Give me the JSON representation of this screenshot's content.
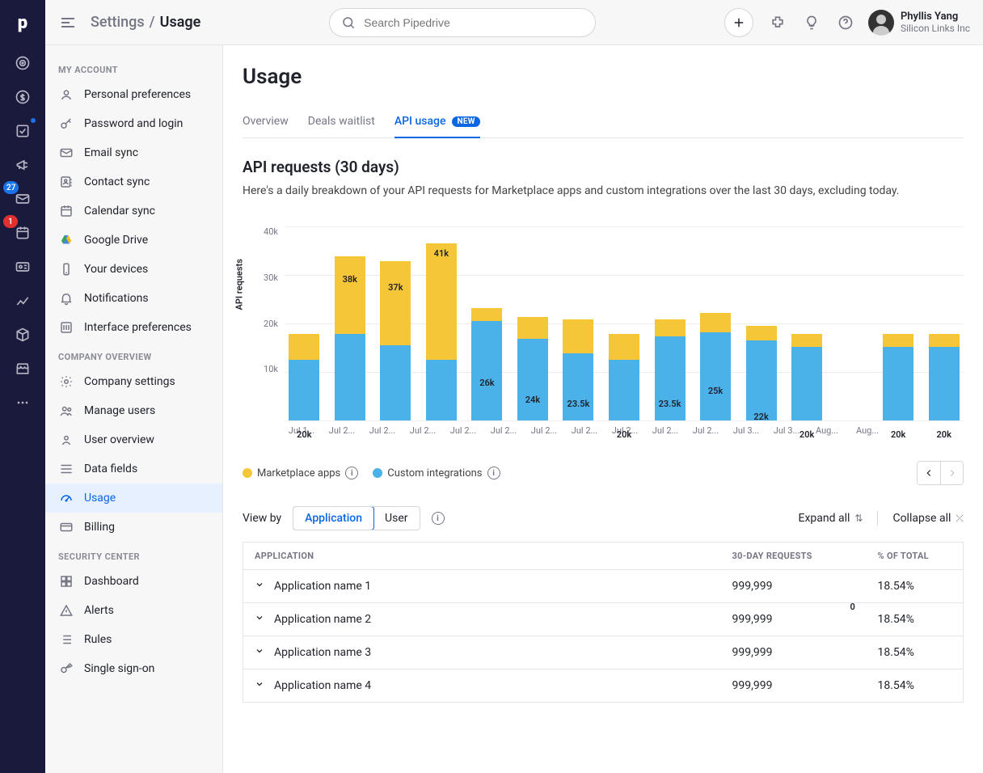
{
  "rail": {
    "items": [
      "target",
      "dollar",
      "checkbox",
      "campaign",
      "inbox",
      "calendar",
      "contact-card",
      "insights",
      "box",
      "store",
      "more"
    ],
    "inbox_badge": "27",
    "calendar_badge": "1"
  },
  "header": {
    "breadcrumb_root": "Settings",
    "breadcrumb_sep": "/",
    "breadcrumb_current": "Usage",
    "search_placeholder": "Search Pipedrive",
    "user_name": "Phyllis Yang",
    "user_company": "Silicon Links Inc"
  },
  "sidebar": {
    "sections": [
      {
        "heading": "MY ACCOUNT",
        "items": [
          {
            "label": "Personal preferences",
            "icon": "user"
          },
          {
            "label": "Password and login",
            "icon": "key"
          },
          {
            "label": "Email sync",
            "icon": "mail"
          },
          {
            "label": "Contact sync",
            "icon": "contacts"
          },
          {
            "label": "Calendar sync",
            "icon": "calendar"
          },
          {
            "label": "Google Drive",
            "icon": "gdrive"
          },
          {
            "label": "Your devices",
            "icon": "device"
          },
          {
            "label": "Notifications",
            "icon": "bell"
          },
          {
            "label": "Interface preferences",
            "icon": "sliders"
          }
        ]
      },
      {
        "heading": "COMPANY OVERVIEW",
        "items": [
          {
            "label": "Company settings",
            "icon": "gear"
          },
          {
            "label": "Manage users",
            "icon": "users"
          },
          {
            "label": "User overview",
            "icon": "userview"
          },
          {
            "label": "Data fields",
            "icon": "fields"
          },
          {
            "label": "Usage",
            "icon": "gauge",
            "active": true
          },
          {
            "label": "Billing",
            "icon": "billing"
          }
        ]
      },
      {
        "heading": "SECURITY CENTER",
        "items": [
          {
            "label": "Dashboard",
            "icon": "dashboard"
          },
          {
            "label": "Alerts",
            "icon": "alert"
          },
          {
            "label": "Rules",
            "icon": "rules"
          },
          {
            "label": "Single sign-on",
            "icon": "sso"
          }
        ]
      }
    ]
  },
  "page": {
    "title": "Usage",
    "tabs": [
      {
        "label": "Overview",
        "active": false
      },
      {
        "label": "Deals waitlist",
        "active": false
      },
      {
        "label": "API usage",
        "active": true,
        "badge": "NEW"
      }
    ],
    "section_title": "API requests (30 days)",
    "section_desc": "Here's a daily breakdown of your API requests for Marketplace apps and custom integrations over the last 30 days, excluding today.",
    "legend": [
      {
        "label": "Marketplace apps",
        "color": "#f5c638"
      },
      {
        "label": "Custom integrations",
        "color": "#4ab2e8"
      }
    ],
    "viewby_label": "View by",
    "viewby_options": [
      "Application",
      "User"
    ],
    "viewby_active": "Application",
    "expand_label": "Expand all",
    "collapse_label": "Collapse all",
    "table": {
      "columns": [
        "APPLICATION",
        "30-DAY REQUESTS",
        "% OF TOTAL"
      ],
      "rows": [
        {
          "app": "Application name 1",
          "reqs": "999,999",
          "pct": "18.54%"
        },
        {
          "app": "Application name 2",
          "reqs": "999,999",
          "pct": "18.54%"
        },
        {
          "app": "Application name 3",
          "reqs": "999,999",
          "pct": "18.54%"
        },
        {
          "app": "Application name 4",
          "reqs": "999,999",
          "pct": "18.54%"
        }
      ]
    }
  },
  "chart_data": {
    "type": "bar",
    "title": "API requests (30 days)",
    "xlabel": "",
    "ylabel": "API requests",
    "ylim": [
      0,
      45000
    ],
    "y_ticks": [
      "40k",
      "30k",
      "20k",
      "10k"
    ],
    "categories": [
      "Jul 1...",
      "Jul 2...",
      "Jul 2...",
      "Jul 2...",
      "Jul 2...",
      "Jul 2...",
      "Jul 2...",
      "Jul 2...",
      "Jul 2...",
      "Jul 2...",
      "Jul 2...",
      "Jul 3...",
      "Jul 3...",
      "Aug...",
      "Aug..."
    ],
    "series": [
      {
        "name": "Custom integrations",
        "color": "#4ab2e8",
        "values": [
          14000,
          20000,
          17500,
          14000,
          23000,
          19000,
          15500,
          14000,
          19500,
          20500,
          18500,
          17000,
          0,
          17000,
          17000
        ]
      },
      {
        "name": "Marketplace apps",
        "color": "#f5c638",
        "values": [
          6000,
          18000,
          19500,
          27000,
          3000,
          5000,
          8000,
          6000,
          4000,
          4500,
          3500,
          3000,
          0,
          3000,
          3000
        ]
      }
    ],
    "totals_labels": [
      "20k",
      "38k",
      "37k",
      "41k",
      "26k",
      "24k",
      "23.5k",
      "20k",
      "23.5k",
      "25k",
      "22k",
      "20k",
      "0",
      "20k",
      "20k"
    ]
  }
}
